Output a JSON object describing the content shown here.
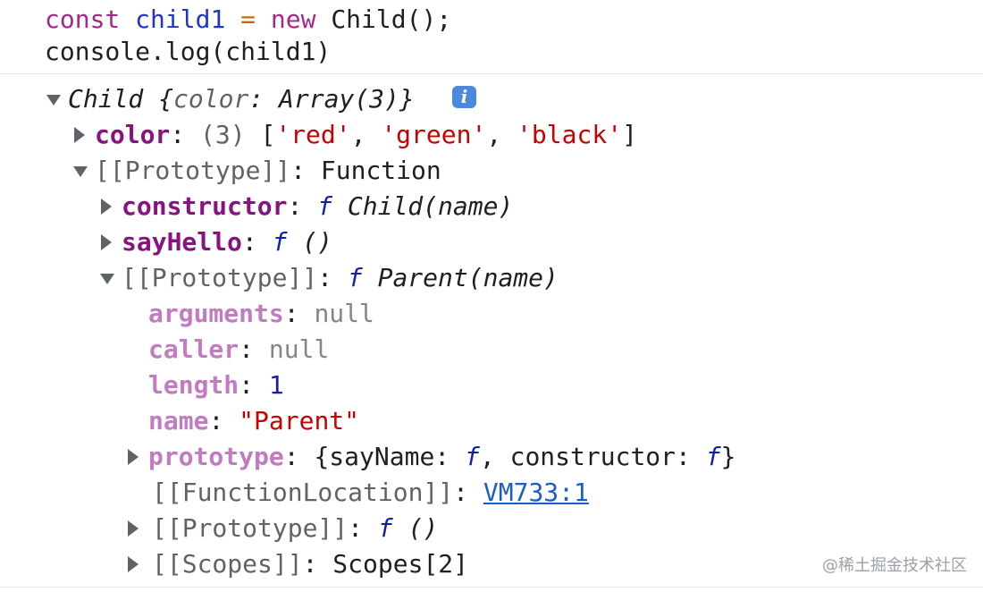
{
  "input": {
    "line1": {
      "kw_const": "const",
      "var_name": "child1",
      "op_equals": "=",
      "kw_new": "new",
      "call": "Child();"
    },
    "line2": "console.log(child1)"
  },
  "tree": {
    "root": {
      "class_name": "Child",
      "summary_open": "{",
      "summary_key": "color",
      "summary_sep": ":",
      "summary_value": "Array(3)",
      "summary_close": "}",
      "info_icon_glyph": "i"
    },
    "color": {
      "key": "color",
      "sep": ":",
      "count": "(3)",
      "open": "[",
      "v1": "'red'",
      "c1": ",",
      "v2": "'green'",
      "c2": ",",
      "v3": "'black'",
      "close": "]"
    },
    "proto1": {
      "key": "[[Prototype]]",
      "sep": ":",
      "value": "Function"
    },
    "constructor": {
      "key": "constructor",
      "sep": ":",
      "f": "f",
      "value": "Child(name)"
    },
    "sayHello": {
      "key": "sayHello",
      "sep": ":",
      "f": "f",
      "value": "()"
    },
    "proto2": {
      "key": "[[Prototype]]",
      "sep": ":",
      "f": "f",
      "value": "Parent(name)"
    },
    "arguments": {
      "key": "arguments",
      "sep": ":",
      "value": "null"
    },
    "caller": {
      "key": "caller",
      "sep": ":",
      "value": "null"
    },
    "length": {
      "key": "length",
      "sep": ":",
      "value": "1"
    },
    "name": {
      "key": "name",
      "sep": ":",
      "value": "\"Parent\""
    },
    "prototype": {
      "key": "prototype",
      "sep": ":",
      "open": "{sayName:",
      "f1": "f",
      "mid": ", constructor:",
      "f2": "f",
      "close": "}"
    },
    "function_location": {
      "key": "[[FunctionLocation]]",
      "sep": ":",
      "link": "VM733:1"
    },
    "proto3": {
      "key": "[[Prototype]]",
      "sep": ":",
      "f": "f",
      "value": "()"
    },
    "scopes": {
      "key": "[[Scopes]]",
      "sep": ":",
      "value": "Scopes[2]"
    }
  },
  "watermark": "@稀土掘金技术社区",
  "colors": {
    "keyword": "#a4278b",
    "variable": "#2035c4",
    "property": "#881280",
    "property_dim": "#c27ac2",
    "string": "#c80000",
    "number": "#1a1aa6",
    "null": "#80868b",
    "function_f": "#0d22aa",
    "link": "#1a5cc8",
    "info_badge": "#4a89dc"
  }
}
